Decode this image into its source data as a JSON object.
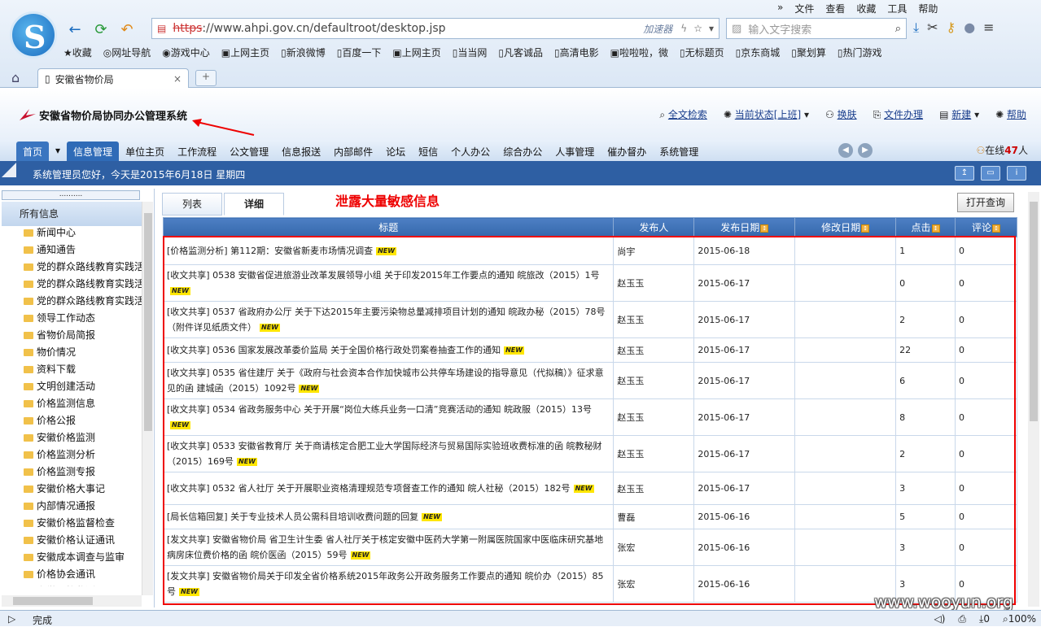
{
  "browser": {
    "top_menu": [
      "文件",
      "查看",
      "收藏",
      "工具",
      "帮助"
    ],
    "url_scheme": "https",
    "url_rest": "://www.ahpi.gov.cn/defaultroot/desktop.jsp",
    "accelerator": "加速器",
    "search_placeholder": "输入文字搜索",
    "bookmarks": [
      "收藏",
      "网址导航",
      "游戏中心",
      "上网主页",
      "新浪微博",
      "百度一下",
      "上网主页",
      "当当网",
      "凡客诚品",
      "高清电影",
      "啦啦啦，微",
      "无标题页",
      "京东商城",
      "聚划算",
      "热门游戏"
    ],
    "tab_title": "安徽省物价局",
    "status_text": "完成",
    "status_count": "0",
    "zoom": "100%"
  },
  "app": {
    "title": "安徽省物价局协同办公管理系统",
    "header_links": [
      "全文检索",
      "当前状态[上班]",
      "换肤",
      "文件办理",
      "新建",
      "帮助"
    ],
    "menus": [
      "首页",
      "信息管理",
      "单位主页",
      "工作流程",
      "公文管理",
      "信息报送",
      "内部邮件",
      "论坛",
      "短信",
      "个人办公",
      "综合办公",
      "人事管理",
      "催办督办",
      "系统管理"
    ],
    "active_menu": 1,
    "online_prefix": "在线",
    "online_count": "47",
    "online_suffix": "人",
    "welcome": "系统管理员您好，今天是2015年6月18日 星期四"
  },
  "sidebar": {
    "top_dots": "..........",
    "title": "所有信息",
    "items": [
      "新闻中心",
      "通知通告",
      "党的群众路线教育实践活",
      "党的群众路线教育实践活",
      "党的群众路线教育实践活",
      "领导工作动态",
      "省物价局简报",
      "物价情况",
      "资料下载",
      "文明创建活动",
      "价格监测信息",
      "价格公报",
      "安徽价格监测",
      "价格监测分析",
      "价格监测专报",
      "安徽价格大事记",
      "内部情况通报",
      "安徽价格监督检查",
      "安徽价格认证通讯",
      "安徽成本调查与监审",
      "价格协会通讯",
      "安徽价格监测通讯"
    ]
  },
  "content": {
    "tabs": [
      "列表",
      "详细"
    ],
    "active_tab": 1,
    "annotation": "泄露大量敏感信息",
    "open_query": "打开查询",
    "columns": [
      "标题",
      "发布人",
      "发布日期",
      "修改日期",
      "点击",
      "评论"
    ],
    "new_tag": "NEW",
    "rows": [
      {
        "title": "[价格监测分析] 第112期：安徽省新麦市场情况调查",
        "author": "尚宇",
        "date": "2015-06-18",
        "modified": "",
        "clicks": "1",
        "comments": "0"
      },
      {
        "title": "[收文共享] 0538 安徽省促进旅游业改革发展领导小组 关于印发2015年工作要点的通知 皖旅改（2015）1号",
        "author": "赵玉玉",
        "date": "2015-06-17",
        "modified": "",
        "clicks": "0",
        "comments": "0"
      },
      {
        "title": "[收文共享] 0537 省政府办公厅 关于下达2015年主要污染物总量减排项目计划的通知 皖政办秘（2015）78号（附件详见纸质文件）",
        "author": "赵玉玉",
        "date": "2015-06-17",
        "modified": "",
        "clicks": "2",
        "comments": "0"
      },
      {
        "title": "[收文共享] 0536 国家发展改革委价监局 关于全国价格行政处罚案卷抽查工作的通知",
        "author": "赵玉玉",
        "date": "2015-06-17",
        "modified": "",
        "clicks": "22",
        "comments": "0"
      },
      {
        "title": "[收文共享] 0535 省住建厅 关于《政府与社会资本合作加快城市公共停车场建设的指导意见（代拟稿）》征求意见的函 建城函（2015）1092号",
        "author": "赵玉玉",
        "date": "2015-06-17",
        "modified": "",
        "clicks": "6",
        "comments": "0"
      },
      {
        "title": "[收文共享] 0534 省政务服务中心 关于开展“岗位大练兵业务一口清”竞赛活动的通知 皖政服（2015）13号",
        "author": "赵玉玉",
        "date": "2015-06-17",
        "modified": "",
        "clicks": "8",
        "comments": "0"
      },
      {
        "title": "[收文共享] 0533 安徽省教育厅 关于商请核定合肥工业大学国际经济与贸易国际实验班收费标准的函 皖教秘财（2015）169号",
        "author": "赵玉玉",
        "date": "2015-06-17",
        "modified": "",
        "clicks": "2",
        "comments": "0"
      },
      {
        "title": "[收文共享] 0532 省人社厅 关于开展职业资格清理规范专项督查工作的通知 皖人社秘（2015）182号",
        "author": "赵玉玉",
        "date": "2015-06-17",
        "modified": "",
        "clicks": "3",
        "comments": "0"
      },
      {
        "title": "[局长信箱回复] 关于专业技术人员公需科目培训收费问题的回复",
        "author": "曹磊",
        "date": "2015-06-16",
        "modified": "",
        "clicks": "5",
        "comments": "0"
      },
      {
        "title": "[发文共享] 安徽省物价局 省卫生计生委 省人社厅关于核定安徽中医药大学第一附属医院国家中医临床研究基地病房床位费价格的函 皖价医函（2015）59号",
        "author": "张宏",
        "date": "2015-06-16",
        "modified": "",
        "clicks": "3",
        "comments": "0"
      },
      {
        "title": "[发文共享] 安徽省物价局关于印发全省价格系统2015年政务公开政务服务工作要点的通知 皖价办（2015）85号",
        "author": "张宏",
        "date": "2015-06-16",
        "modified": "",
        "clicks": "3",
        "comments": "0"
      }
    ]
  },
  "watermark": "www.wooyun.org"
}
